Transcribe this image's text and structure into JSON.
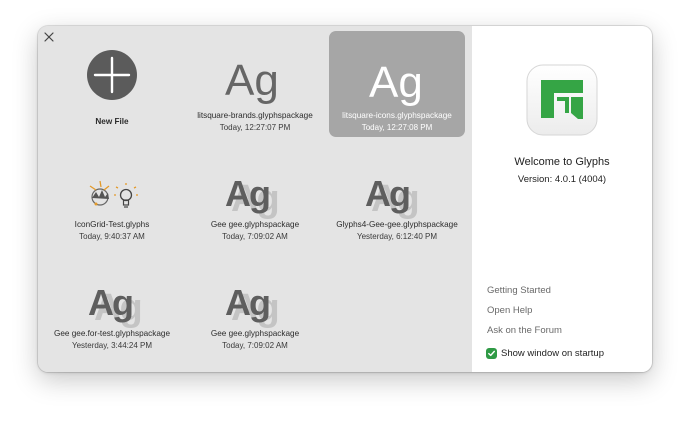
{
  "recent_files": [
    {
      "name": "New File",
      "date": "",
      "kind": "new"
    },
    {
      "name": "litsquare-brands.glyphspackage",
      "date": "Today, 12:27:07 PM",
      "kind": "ag-plain",
      "preview_text": "Ag"
    },
    {
      "name": "litsquare-icons.glyphspackage",
      "date": "Today, 12:27:08 PM",
      "kind": "ag-plain",
      "preview_text": "Ag",
      "selected": true
    },
    {
      "name": "IconGrid-Test.glyphs",
      "date": "Today, 9:40:37 AM",
      "kind": "icons"
    },
    {
      "name": "Gee gee.glyphspackage",
      "date": "Today, 7:09:02 AM",
      "kind": "ag-shadow",
      "preview_text": "Ag"
    },
    {
      "name": "Glyphs4-Gee-gee.glyphspackage",
      "date": "Yesterday, 6:12:40 PM",
      "kind": "ag-shadow",
      "preview_text": "Ag"
    },
    {
      "name": "Gee gee.for-test.glyphspackage",
      "date": "Yesterday, 3:44:24 PM",
      "kind": "ag-shadow",
      "preview_text": "Ag"
    },
    {
      "name": "Gee gee.glyphspackage",
      "date": "Today, 7:09:02 AM",
      "kind": "ag-shadow",
      "preview_text": "Ag"
    }
  ],
  "welcome": {
    "title": "Welcome to Glyphs",
    "version": "Version: 4.0.1 (4004)"
  },
  "links": {
    "getting_started": "Getting Started",
    "open_help": "Open Help",
    "forum": "Ask on the Forum"
  },
  "startup": {
    "label": "Show window on startup",
    "checked": true
  },
  "colors": {
    "selection": "#a6a6a6",
    "brand_green": "#35a545",
    "checkbox_green": "#2f9a45"
  }
}
